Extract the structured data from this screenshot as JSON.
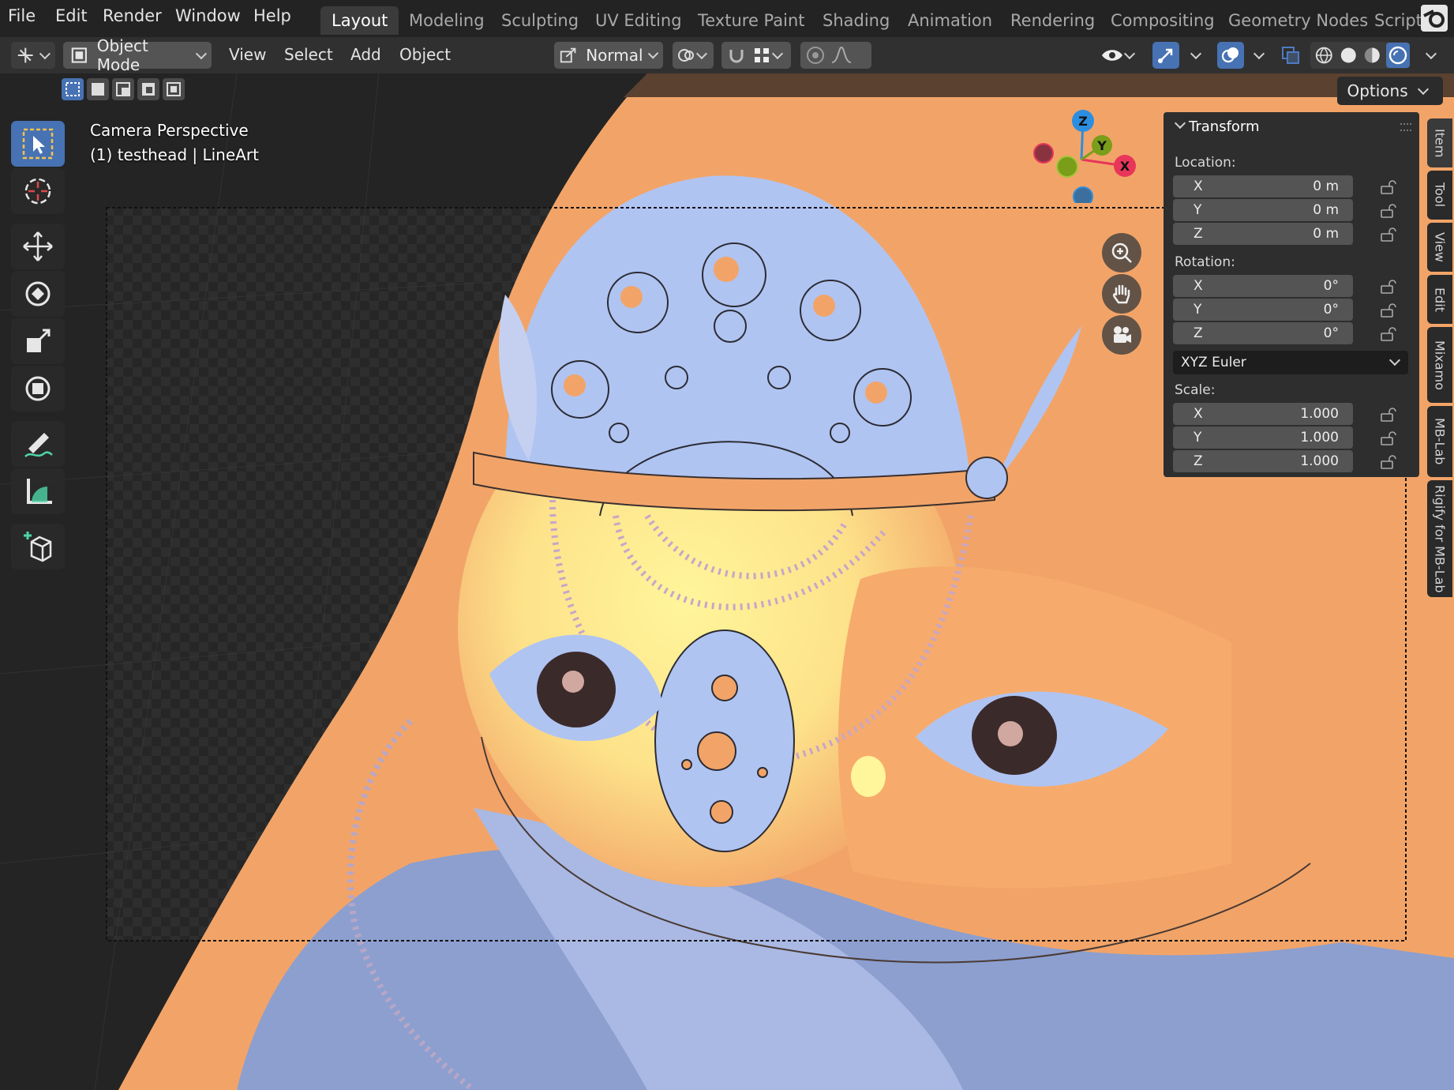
{
  "menu": {
    "items": [
      "File",
      "Edit",
      "Render",
      "Window",
      "Help"
    ]
  },
  "workspaces": {
    "tabs": [
      "Layout",
      "Modeling",
      "Sculpting",
      "UV Editing",
      "Texture Paint",
      "Shading",
      "Animation",
      "Rendering",
      "Compositing",
      "Geometry Nodes",
      "Script"
    ],
    "active": "Layout"
  },
  "header": {
    "mode": "Object Mode",
    "menus": [
      "View",
      "Select",
      "Add",
      "Object"
    ],
    "orientation": "Normal"
  },
  "viewport": {
    "view_name": "Camera Perspective",
    "object_info": "(1) testhead | LineArt",
    "options_label": "Options",
    "gizmo": {
      "x": "X",
      "y": "Y",
      "z": "Z"
    }
  },
  "transform_panel": {
    "title": "Transform",
    "location_label": "Location:",
    "location": [
      {
        "axis": "X",
        "value": "0 m"
      },
      {
        "axis": "Y",
        "value": "0 m"
      },
      {
        "axis": "Z",
        "value": "0 m"
      }
    ],
    "rotation_label": "Rotation:",
    "rotation": [
      {
        "axis": "X",
        "value": "0°"
      },
      {
        "axis": "Y",
        "value": "0°"
      },
      {
        "axis": "Z",
        "value": "0°"
      }
    ],
    "rotation_mode": "XYZ Euler",
    "scale_label": "Scale:",
    "scale": [
      {
        "axis": "X",
        "value": "1.000"
      },
      {
        "axis": "Y",
        "value": "1.000"
      },
      {
        "axis": "Z",
        "value": "1.000"
      }
    ]
  },
  "sidebar_tabs": [
    "Item",
    "Tool",
    "View",
    "Edit",
    "Mixamo",
    "MB-Lab",
    "Rigify for MB-Lab"
  ],
  "colors": {
    "accent": "#4772b3",
    "skin_orange": "#f2a468",
    "line_blue": "#b0c4f2",
    "highlight_yellow": "#fff59a",
    "axis_x": "#e8365a",
    "axis_y": "#7a9e1a",
    "axis_z": "#2c8ee0"
  }
}
